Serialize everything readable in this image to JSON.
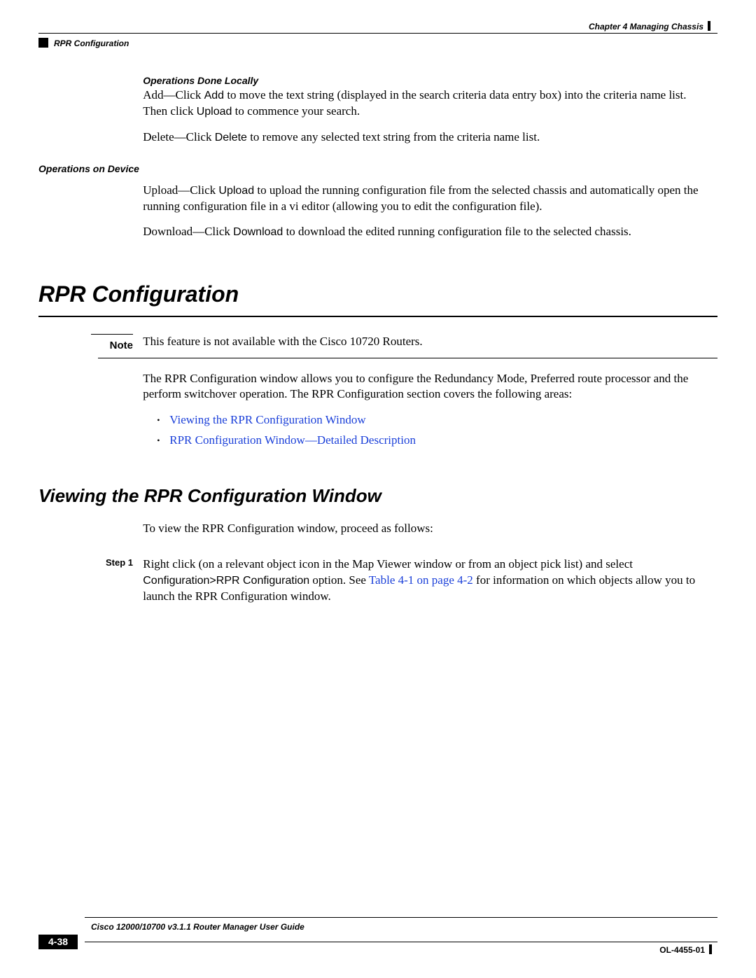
{
  "header": {
    "chapter": "Chapter 4      Managing Chassis",
    "section_running": "RPR Configuration"
  },
  "ops_local": {
    "heading": "Operations Done Locally",
    "add_prefix": "Add—Click ",
    "add_btn": "Add",
    "add_mid": " to move the text string (displayed in the search criteria data entry box) into the criteria name list. Then click ",
    "upload_btn": "Upload",
    "add_suffix": " to commence your search.",
    "del_prefix": "Delete—Click ",
    "del_btn": "Delete",
    "del_suffix": " to remove any selected text string from the criteria name list."
  },
  "ops_device": {
    "heading": "Operations on Device",
    "up_prefix": "Upload—Click ",
    "up_btn": "Upload",
    "up_suffix": " to upload the running configuration file from the selected chassis and automatically open the running configuration file in a vi editor (allowing you to edit the configuration file).",
    "dl_prefix": "Download—Click ",
    "dl_btn": "Download",
    "dl_suffix": " to download the edited running configuration file to the selected chassis."
  },
  "rpr": {
    "title": "RPR Configuration",
    "note_label": "Note",
    "note_text": "This feature is not available with the Cisco 10720 Routers.",
    "intro": "The RPR Configuration window allows you to configure the Redundancy Mode, Preferred route processor and the perform switchover operation. The RPR Configuration section covers the following areas:",
    "link1": "Viewing the RPR Configuration Window",
    "link2": "RPR Configuration Window—Detailed Description"
  },
  "viewing": {
    "title": "Viewing the RPR Configuration Window",
    "lead": "To view the RPR Configuration window, proceed as follows:",
    "step_label": "Step 1",
    "step_text_a": "Right click (on a relevant object icon in the Map Viewer window or from an object pick list) and select ",
    "step_cmd": "Configuration>RPR Configuration",
    "step_text_b": " option. See ",
    "step_link": "Table 4-1 on page 4-2",
    "step_text_c": " for information on which objects allow you to launch the RPR Configuration window."
  },
  "footer": {
    "book": "Cisco 12000/10700 v3.1.1 Router Manager User Guide",
    "page": "4-38",
    "docnum": "OL-4455-01"
  }
}
